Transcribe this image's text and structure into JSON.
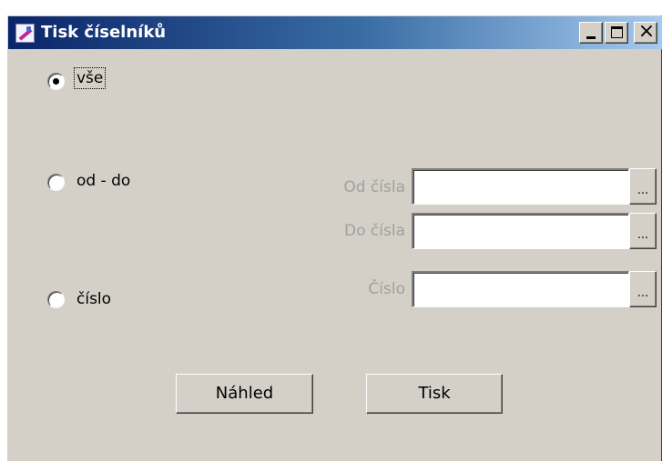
{
  "window": {
    "title": "Tisk číselníků",
    "icon": "print-dictionary-app-icon",
    "minimize_glyph": "_",
    "maximize_glyph": "□",
    "close_glyph": "×"
  },
  "options": [
    {
      "label": "vše",
      "checked": true
    },
    {
      "label": "od - do",
      "checked": false
    },
    {
      "label": "číslo",
      "checked": false
    }
  ],
  "fields": {
    "from": {
      "label": "Od čísla",
      "value": ""
    },
    "to": {
      "label": "Do čísla",
      "value": ""
    },
    "number": {
      "label": "Číslo",
      "value": ""
    }
  },
  "browse_label": "...",
  "buttons": {
    "preview": "Náhled",
    "print": "Tisk"
  },
  "colors": {
    "window_bg": "#d4d0c8",
    "title_gradient_start": "#0a246a",
    "title_gradient_end": "#a6caf0",
    "disabled_text": "#a0a0a0"
  }
}
